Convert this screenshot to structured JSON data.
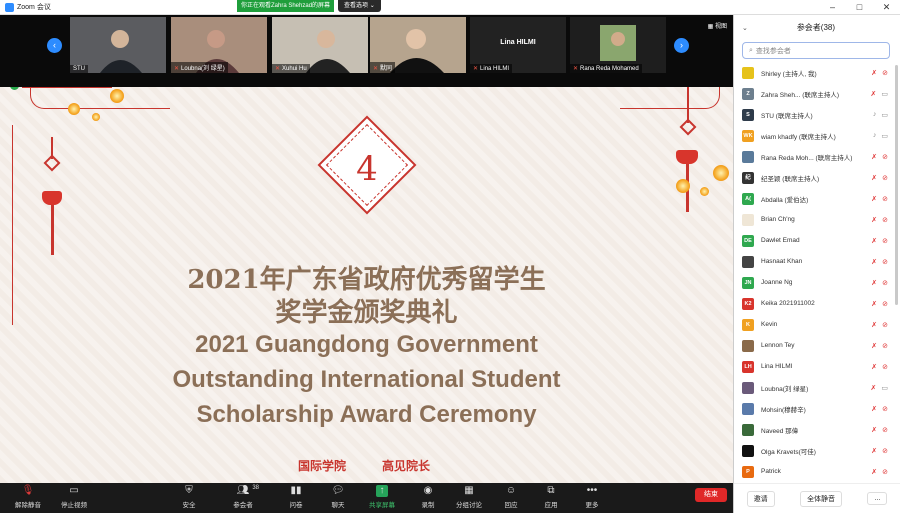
{
  "window": {
    "title": "Zoom 会议"
  },
  "share_banner": {
    "message": "你正在观看Zahra Shehzad的屏幕",
    "options_label": "查看选项 ⌄"
  },
  "strip": {
    "view_label": "视图",
    "tiles": [
      {
        "name": "STU"
      },
      {
        "name": "Loubna(刘 绿星)"
      },
      {
        "name": "Xuhui Hu"
      },
      {
        "name": "默同"
      },
      {
        "name": "Lina HILMI",
        "display_name": "Lina HILMI"
      },
      {
        "name": "Rana Reda Mohamed"
      }
    ]
  },
  "slide": {
    "number": "4",
    "title_zh_line1": "2021年广东省政府优秀留学生",
    "title_zh_line2": "奖学金颁奖典礼",
    "title_en_line1": "2021 Guangdong Government",
    "title_en_line2": "Outstanding International Student",
    "title_en_line3": "Scholarship Award Ceremony",
    "presenter_org": "国际学院",
    "presenter_name": "高见院长"
  },
  "toolbar": {
    "unmute": "解除静音",
    "stop_video": "停止视频",
    "security": "安全",
    "participants": "参会者",
    "participants_count": "38",
    "polls": "问卷",
    "chat": "聊天",
    "share": "共享屏幕",
    "record": "录制",
    "breakout": "分组讨论",
    "reactions": "回应",
    "apps": "应用",
    "more": "更多",
    "end": "结束"
  },
  "panel": {
    "title": "参会者(38)",
    "search_placeholder": "查找参会者",
    "invite": "邀请",
    "mute_all": "全体静音",
    "more": "...",
    "participants": [
      {
        "name": "Shirley (主持人, 我)",
        "initials": "",
        "color": "#e6c21a",
        "mic": "off",
        "cam": "off"
      },
      {
        "name": "Zahra Sheh... (联席主持人)",
        "initials": "Z",
        "color": "#6d7f8e",
        "mic": "off",
        "cam": "on"
      },
      {
        "name": "STU (联席主持人)",
        "initials": "S",
        "color": "#2e3b4a",
        "mic": "on",
        "cam": "on"
      },
      {
        "name": "wiam khadfy (联席主持人)",
        "initials": "WK",
        "color": "#f0a020",
        "mic": "on",
        "cam": "on"
      },
      {
        "name": "Rana Reda Moh... (联席主持人)",
        "initials": "",
        "color": "#5a7a9a",
        "mic": "off",
        "cam": "off"
      },
      {
        "name": "纪圣颖 (联席主持人)",
        "initials": "纪",
        "color": "#333",
        "mic": "off",
        "cam": "off"
      },
      {
        "name": "Abdalla (爱伯达)",
        "initials": "A(",
        "color": "#2fa84f",
        "mic": "off",
        "cam": "off"
      },
      {
        "name": "Brian Ch'ng",
        "initials": "",
        "color": "#efe6d6",
        "mic": "off",
        "cam": "off"
      },
      {
        "name": "Dawlet Emad",
        "initials": "DE",
        "color": "#2fa84f",
        "mic": "off",
        "cam": "off"
      },
      {
        "name": "Hasnaat Khan",
        "initials": "",
        "color": "#444",
        "mic": "off",
        "cam": "off"
      },
      {
        "name": "Joanne Ng",
        "initials": "JN",
        "color": "#2fa84f",
        "mic": "off",
        "cam": "off"
      },
      {
        "name": "Keika 2021911002",
        "initials": "K2",
        "color": "#d8342c",
        "mic": "off",
        "cam": "off"
      },
      {
        "name": "Kevin",
        "initials": "K",
        "color": "#f0a020",
        "mic": "off",
        "cam": "off"
      },
      {
        "name": "Lennon Tey",
        "initials": "",
        "color": "#8a6a4a",
        "mic": "off",
        "cam": "off"
      },
      {
        "name": "Lina HILMI",
        "initials": "LH",
        "color": "#d8342c",
        "mic": "off",
        "cam": "off"
      },
      {
        "name": "Loubna(刘 绿星)",
        "initials": "",
        "color": "#6a5a7a",
        "mic": "off",
        "cam": "on"
      },
      {
        "name": "Mohsin(穆赫辛)",
        "initials": "",
        "color": "#5a7aaa",
        "mic": "off",
        "cam": "off"
      },
      {
        "name": "Naveed 那偉",
        "initials": "",
        "color": "#3a6a3a",
        "mic": "off",
        "cam": "off"
      },
      {
        "name": "Olga Kravets(可佳)",
        "initials": "",
        "color": "#111",
        "mic": "off",
        "cam": "off"
      },
      {
        "name": "Patrick",
        "initials": "P",
        "color": "#e86a10",
        "mic": "off",
        "cam": "off"
      }
    ]
  }
}
